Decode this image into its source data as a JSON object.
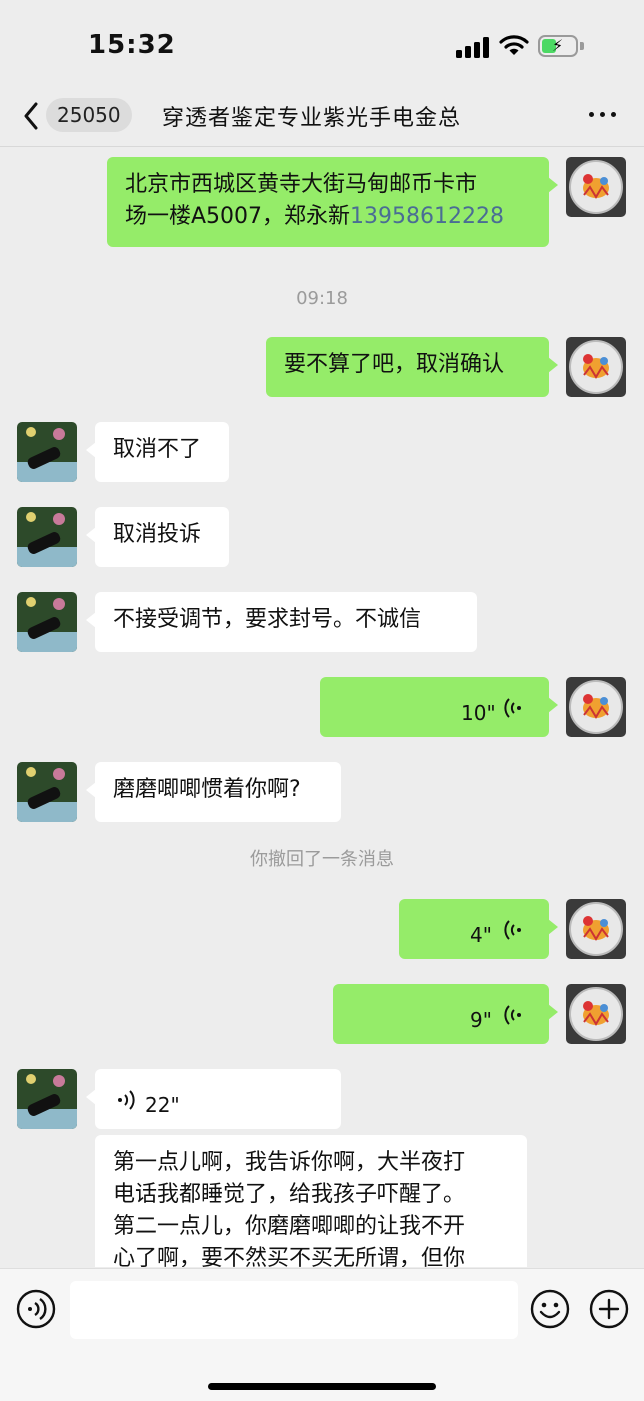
{
  "status": {
    "time": "15:32"
  },
  "nav": {
    "back_count": "25050",
    "title": "穿透者鉴定专业紫光手电金总"
  },
  "messages": {
    "m1": {
      "line1": "北京市西城区黄寺大街马甸邮币卡市",
      "line2_prefix": "场一楼A5007，郑永新",
      "phone": "13958612228"
    },
    "time1": "09:18",
    "m2": "要不算了吧，取消确认",
    "m3": "取消不了",
    "m4": "取消投诉",
    "m5": "不接受调节，要求封号。不诚信",
    "m6": "10\"",
    "m7": "磨磨唧唧惯着你啊?",
    "recall": "你撤回了一条消息",
    "m8": "4\"",
    "m9": "9\"",
    "m10": "22\"",
    "m11": {
      "line1": "第一点儿啊，我告诉你啊，大半夜打",
      "line2": "电话我都睡觉了，给我孩子吓醒了。",
      "line3": "第二一点儿，你磨磨唧唧的让我不开",
      "line4": "心了啊，要不然买不买无所谓，但你"
    }
  },
  "input": {
    "placeholder": ""
  },
  "colors": {
    "sent_bubble": "#95ec69",
    "received_bubble": "#ffffff",
    "background": "#ededed",
    "link": "#4a6d94"
  }
}
